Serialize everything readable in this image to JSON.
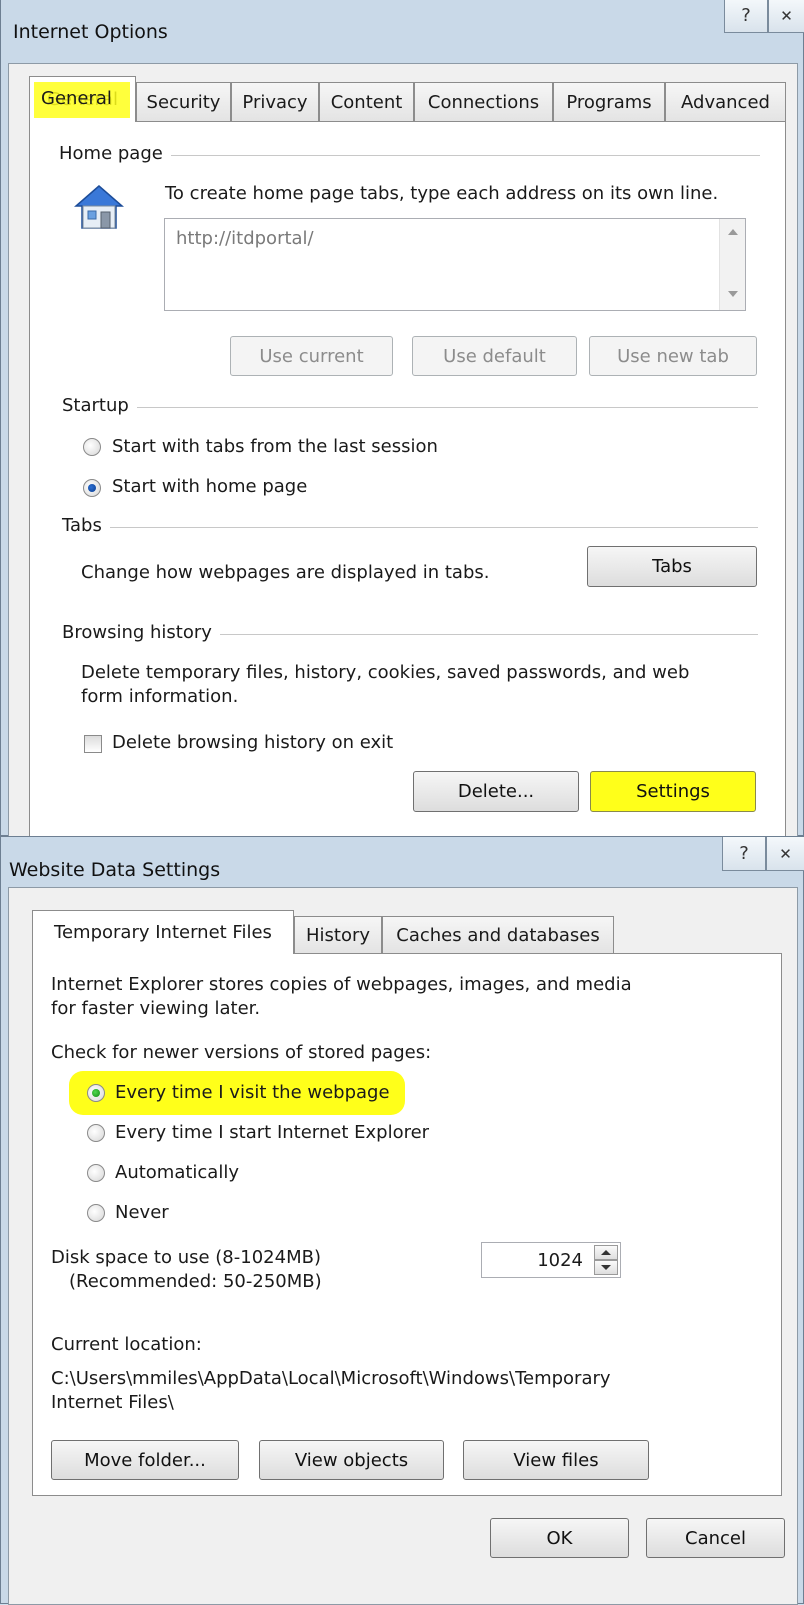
{
  "internet_options": {
    "title": "Internet Options",
    "help_glyph": "?",
    "close_glyph": "✕",
    "tabs": [
      "General",
      "Security",
      "Privacy",
      "Content",
      "Connections",
      "Programs",
      "Advanced"
    ],
    "home_page": {
      "group_label": "Home page",
      "instruction": "To create home page tabs, type each address on its own line.",
      "url_value": "http://itdportal/",
      "use_current": "Use current",
      "use_default": "Use default",
      "use_new_tab": "Use new tab"
    },
    "startup": {
      "group_label": "Startup",
      "option_last_session": "Start with tabs from the last session",
      "option_home_page": "Start with home page"
    },
    "tabs_section": {
      "group_label": "Tabs",
      "description": "Change how webpages are displayed in tabs.",
      "button": "Tabs"
    },
    "browsing_history": {
      "group_label": "Browsing history",
      "description_line1": "Delete temporary files, history, cookies, saved passwords, and web",
      "description_line2": "form information.",
      "checkbox_label": "Delete browsing history on exit",
      "delete_button": "Delete...",
      "settings_button": "Settings"
    }
  },
  "website_data_settings": {
    "title": "Website Data Settings",
    "help_glyph": "?",
    "close_glyph": "✕",
    "tabs": [
      "Temporary Internet Files",
      "History",
      "Caches and databases"
    ],
    "description_line1": "Internet Explorer stores copies of webpages, images, and media",
    "description_line2": "for faster viewing later.",
    "check_label": "Check for newer versions of stored pages:",
    "options": [
      "Every time I visit the webpage",
      "Every time I start Internet Explorer",
      "Automatically",
      "Never"
    ],
    "selected_option": "Every time I visit the webpage",
    "disk_space_label": "Disk space to use (8-1024MB)",
    "disk_space_recommended": "(Recommended: 50-250MB)",
    "disk_space_value": "1024",
    "current_location_label": "Current location:",
    "current_location_line1": "C:\\Users\\mmiles\\AppData\\Local\\Microsoft\\Windows\\Temporary",
    "current_location_line2": "Internet Files\\",
    "move_folder": "Move folder...",
    "view_objects": "View objects",
    "view_files": "View files",
    "ok": "OK",
    "cancel": "Cancel"
  },
  "colors": {
    "highlight": "#ffff1a",
    "titlebar": "#c9d9e8",
    "dialog_bg": "#f0f0f0",
    "panel_bg": "#ffffff"
  }
}
